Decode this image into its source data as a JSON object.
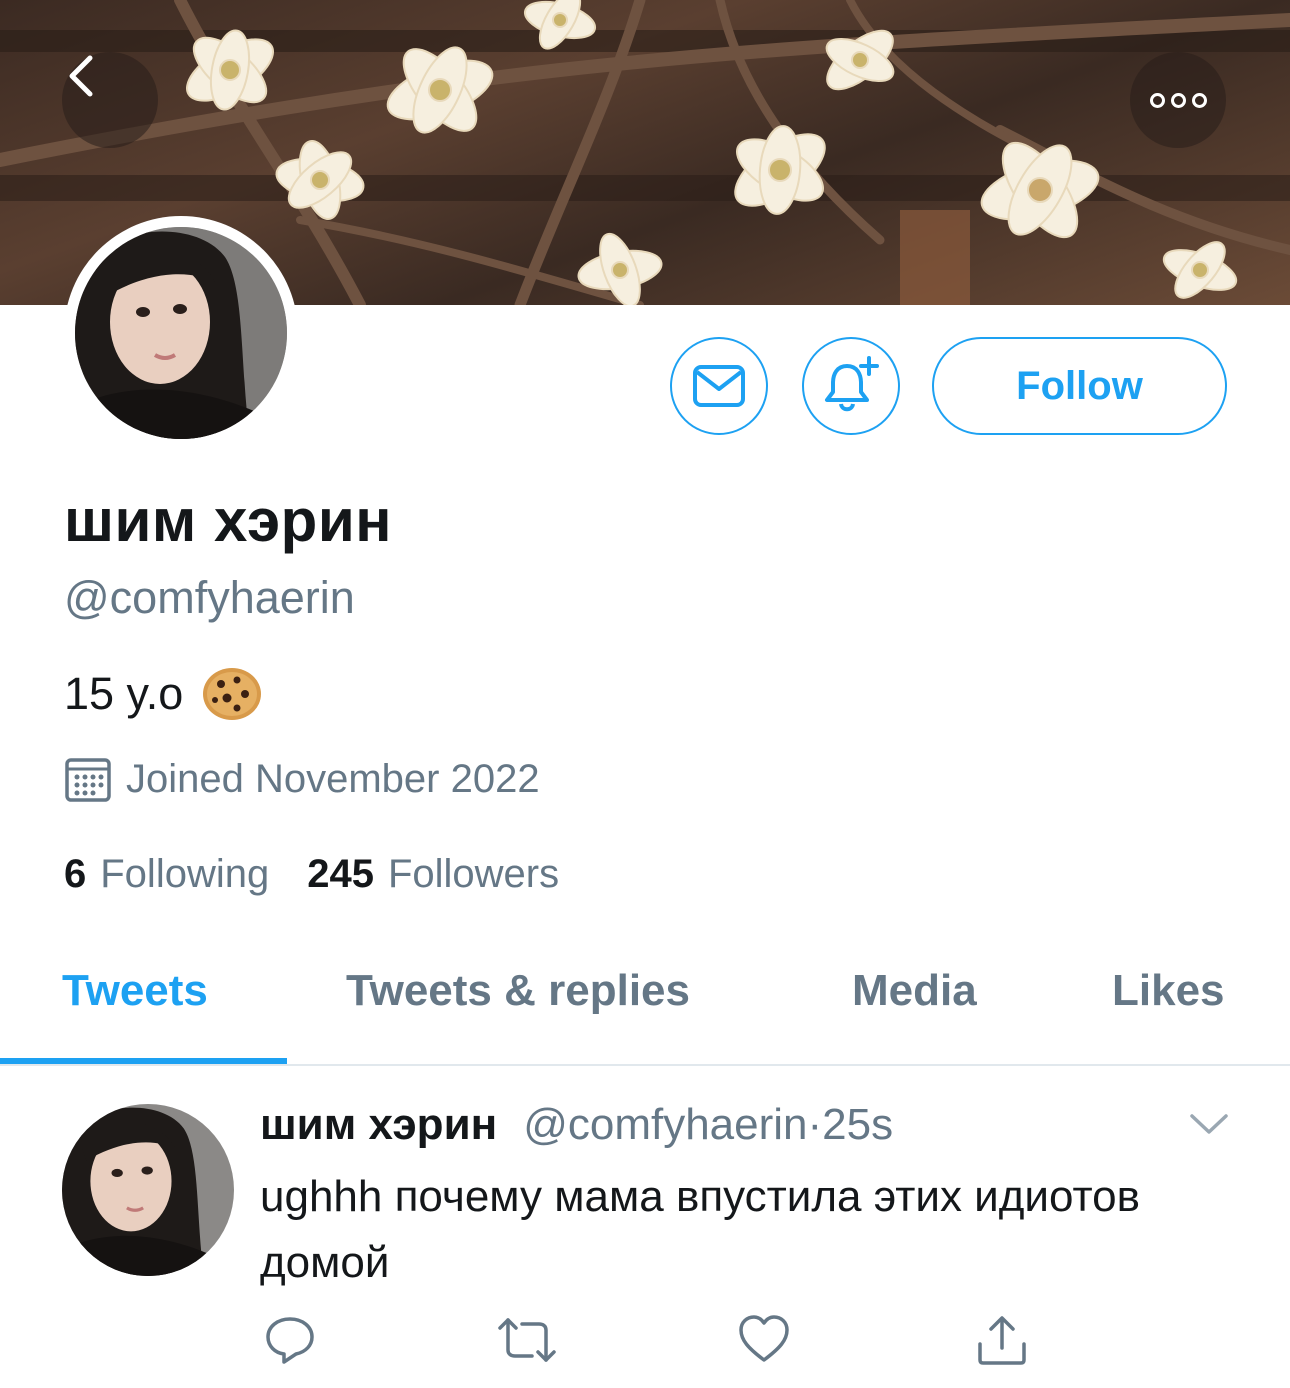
{
  "profile": {
    "display_name": "шим хэрин",
    "handle": "@comfyhaerin",
    "bio": "15 y.o",
    "bio_emoji": "cookie",
    "joined": "Joined November 2022",
    "following_count": "6",
    "following_label": "Following",
    "followers_count": "245",
    "followers_label": "Followers"
  },
  "actions": {
    "follow_label": "Follow",
    "message_icon": "mail-icon",
    "notify_icon": "bell-plus-icon",
    "back_icon": "chevron-left-icon",
    "more_icon": "more-icon"
  },
  "tabs": [
    {
      "label": "Tweets",
      "active": true
    },
    {
      "label": "Tweets & replies",
      "active": false
    },
    {
      "label": "Media",
      "active": false
    },
    {
      "label": "Likes",
      "active": false
    }
  ],
  "tweet": {
    "name": "шим хэрин",
    "handle": "@comfyhaerin",
    "separator": "·",
    "time": "25s",
    "text": "ughhh почему мама впустила этих идиотов домой",
    "actions": [
      "reply-icon",
      "retweet-icon",
      "like-icon",
      "share-icon"
    ]
  },
  "colors": {
    "accent": "#1da1f2",
    "text_primary": "#14171a",
    "text_secondary": "#657786",
    "divider": "#e1e8ed"
  }
}
